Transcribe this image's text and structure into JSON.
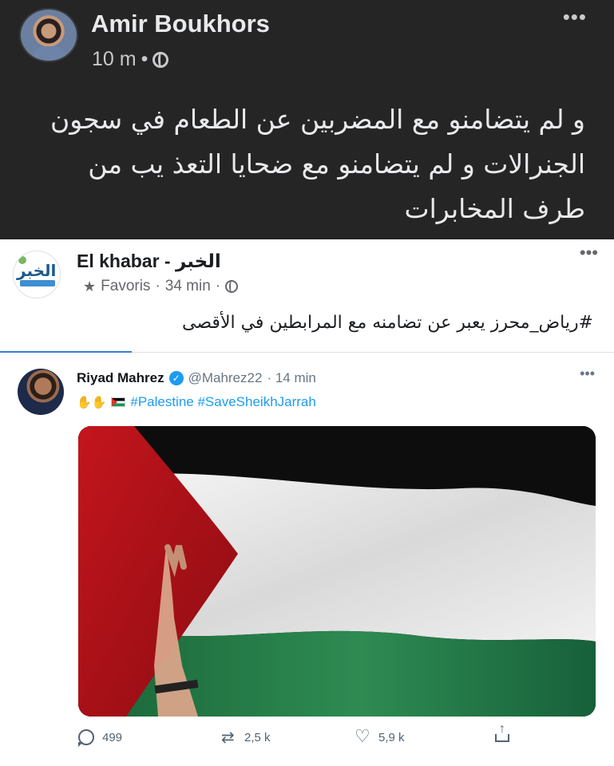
{
  "outer_post": {
    "author": "Amir Boukhors",
    "time": "10 m",
    "separator": "•",
    "more": "•••",
    "text": "و لم يتضامنو مع المضربين عن الطعام في سجون الجنرالات و لم يتضامنو مع ضحايا التعذ يب من طرف المخابرات"
  },
  "shared_post": {
    "page_name": "El khabar - الخبر",
    "logo_text": "الخبر",
    "favoris": "Favoris",
    "time": "34 min",
    "dot": "·",
    "more": "•••",
    "hashtag": "#رياض_محرز",
    "caption_rest": " يعبر عن تضامنه مع المرابطين في الأقصى"
  },
  "tweet": {
    "name": "Riyad Mahrez",
    "handle": "@Mahrez22",
    "time": "· 14 min",
    "more": "•••",
    "hashtags": "#Palestine #SaveSheikhJarrah",
    "actions": {
      "replies": "499",
      "retweets": "2,5 k",
      "likes": "5,9 k"
    }
  },
  "colors": {
    "dark_bg": "#252526",
    "twitter_blue": "#1d9bf0",
    "flag_red": "#e4312b",
    "flag_green": "#149954"
  }
}
